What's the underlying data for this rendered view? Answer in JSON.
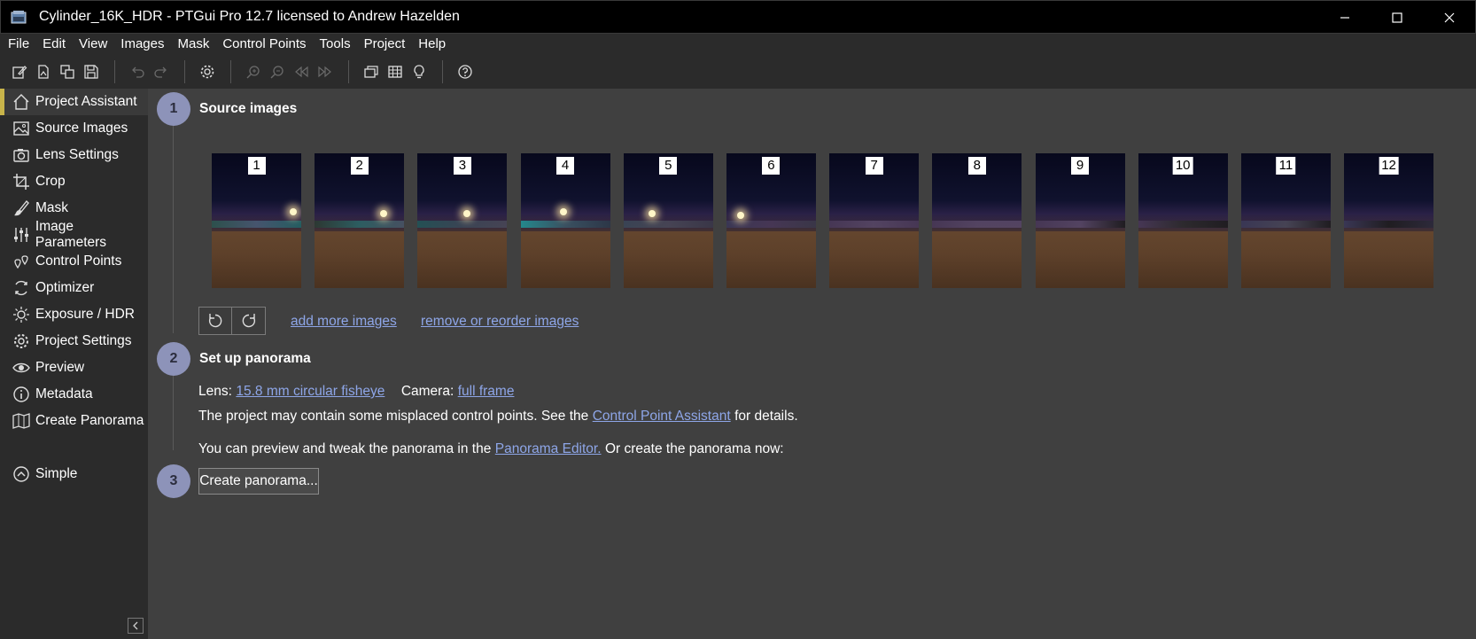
{
  "window": {
    "title": "Cylinder_16K_HDR - PTGui Pro 12.7 licensed to Andrew Hazelden"
  },
  "menu": [
    "File",
    "Edit",
    "View",
    "Images",
    "Mask",
    "Control Points",
    "Tools",
    "Project",
    "Help"
  ],
  "toolbar": [
    "new-project-icon",
    "open-icon",
    "duplicate-icon",
    "save-icon",
    "undo-icon",
    "redo-icon",
    "settings-icon",
    "zoom-in-icon",
    "zoom-out-icon",
    "previous-icon",
    "next-icon",
    "panorama-editor-icon",
    "table-icon",
    "lightbulb-icon",
    "help-icon"
  ],
  "sidebar": {
    "items": [
      {
        "label": "Project Assistant",
        "icon": "home-icon",
        "active": true
      },
      {
        "label": "Source Images",
        "icon": "image-icon"
      },
      {
        "label": "Lens Settings",
        "icon": "camera-icon"
      },
      {
        "label": "Crop",
        "icon": "crop-icon"
      },
      {
        "label": "Mask",
        "icon": "brush-icon"
      },
      {
        "label": "Image Parameters",
        "icon": "sliders-icon"
      },
      {
        "label": "Control Points",
        "icon": "control-points-icon"
      },
      {
        "label": "Optimizer",
        "icon": "optimizer-icon"
      },
      {
        "label": "Exposure / HDR",
        "icon": "sun-icon"
      },
      {
        "label": "Project Settings",
        "icon": "gear-icon"
      },
      {
        "label": "Preview",
        "icon": "eye-icon"
      },
      {
        "label": "Metadata",
        "icon": "info-icon"
      },
      {
        "label": "Create Panorama",
        "icon": "map-icon"
      }
    ],
    "simple": {
      "label": "Simple",
      "icon": "chevron-up-circle-icon"
    }
  },
  "steps": {
    "step1": {
      "number": "1",
      "title": "Source images"
    },
    "step2": {
      "number": "2",
      "title": "Set up panorama"
    },
    "step3": {
      "number": "3"
    }
  },
  "thumbnails": [
    "1",
    "2",
    "3",
    "4",
    "5",
    "6",
    "7",
    "8",
    "9",
    "10",
    "11",
    "12"
  ],
  "links": {
    "add_more": "add more images",
    "remove_reorder": "remove or reorder images"
  },
  "setup": {
    "lens_label": "Lens:",
    "lens_value": "15.8 mm circular fisheye",
    "camera_label": "Camera:",
    "camera_value": "full frame",
    "cp_text_1": "The project may contain some misplaced control points. See the",
    "cp_link": "Control Point Assistant",
    "cp_text_2": "for details.",
    "pe_text_1": "You can preview and tweak the panorama in the",
    "pe_link": "Panorama Editor.",
    "pe_text_2": "Or create the panorama now:"
  },
  "create_button": "Create panorama..."
}
